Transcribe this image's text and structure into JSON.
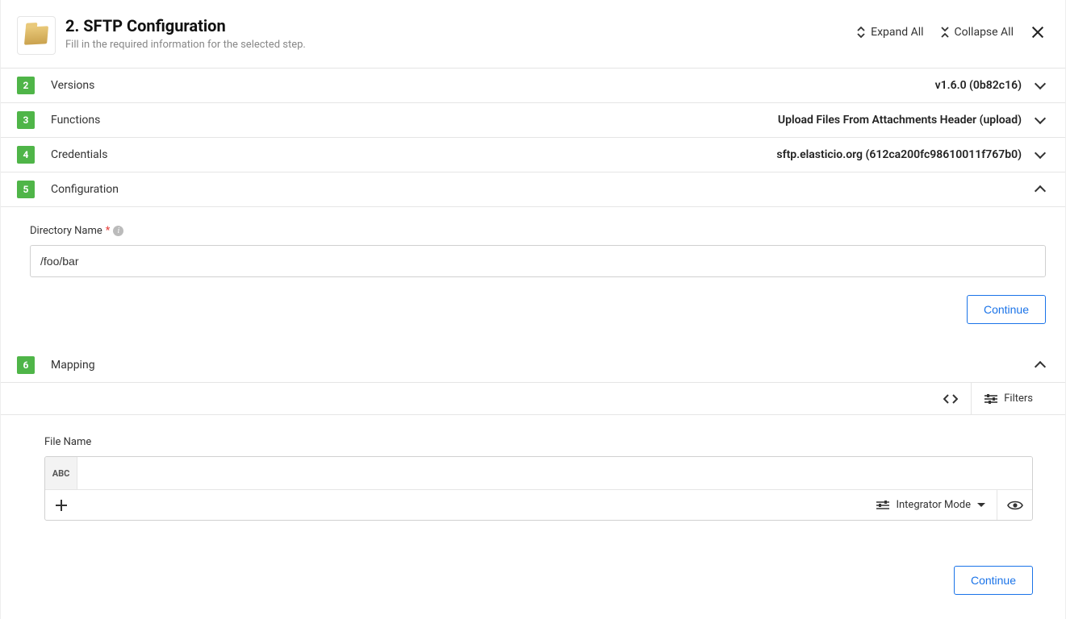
{
  "header": {
    "title": "2. SFTP Configuration",
    "subtitle": "Fill in the required information for the selected step.",
    "expand_all": "Expand All",
    "collapse_all": "Collapse All"
  },
  "sections": {
    "versions": {
      "num": "2",
      "label": "Versions",
      "value": "v1.6.0 (0b82c16)"
    },
    "functions": {
      "num": "3",
      "label": "Functions",
      "value": "Upload Files From Attachments Header (upload)"
    },
    "credentials": {
      "num": "4",
      "label": "Credentials",
      "value": "sftp.elasticio.org (612ca200fc98610011f767b0)"
    },
    "configuration": {
      "num": "5",
      "label": "Configuration",
      "value": ""
    },
    "mapping": {
      "num": "6",
      "label": "Mapping",
      "value": ""
    }
  },
  "configuration": {
    "directory_label": "Directory Name",
    "directory_value": "/foo/bar",
    "continue": "Continue"
  },
  "mapping": {
    "filters_label": "Filters",
    "filename_label": "File Name",
    "abc_chip": "ABC",
    "filename_value": "",
    "mode_label": "Integrator Mode",
    "continue": "Continue"
  }
}
